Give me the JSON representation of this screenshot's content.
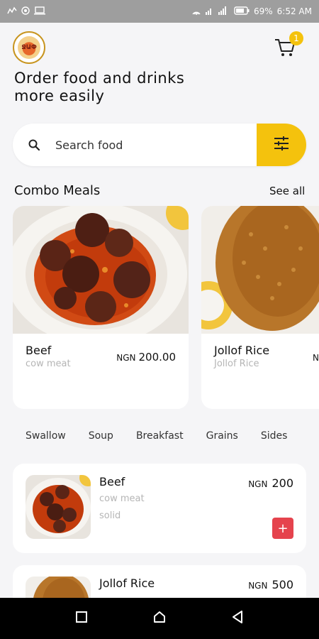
{
  "statusbar": {
    "battery": "69%",
    "time": "6:52 AM"
  },
  "header": {
    "logo_text": "ՋԱՓ",
    "cart_count": "1",
    "headline": "Order food and drinks more easily"
  },
  "search": {
    "placeholder": "Search food"
  },
  "combo": {
    "title": "Combo Meals",
    "see_all": "See all",
    "cards": [
      {
        "name": "Beef",
        "sub": "cow meat",
        "currency": "NGN",
        "price": "200.00"
      },
      {
        "name": "Jollof Rice",
        "sub": "Jollof Rice",
        "currency": "N"
      }
    ]
  },
  "categories": [
    "Swallow",
    "Soup",
    "Breakfast",
    "Grains",
    "Sides"
  ],
  "items": [
    {
      "name": "Beef",
      "sub": "cow meat",
      "type": "solid",
      "currency": "NGN",
      "price": "200",
      "add": "+"
    },
    {
      "name": "Jollof Rice",
      "currency": "NGN",
      "price": "500"
    }
  ],
  "colors": {
    "accent": "#f4c20d",
    "add_button": "#e5434d",
    "muted_text": "#b5b5b5"
  }
}
